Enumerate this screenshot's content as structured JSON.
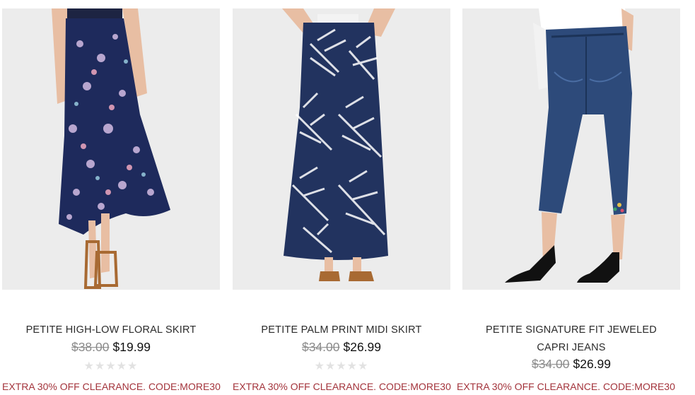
{
  "products": [
    {
      "name": "PETITE HIGH-LOW FLORAL SKIRT",
      "original_price": "$38.00",
      "sale_price": "$19.99",
      "rating_stars": "★★★★★",
      "rating_filled": 0,
      "promo": "EXTRA 30% OFF CLEARANCE. CODE:MORE30"
    },
    {
      "name": "PETITE PALM PRINT MIDI SKIRT",
      "original_price": "$34.00",
      "sale_price": "$26.99",
      "rating_stars": "★★★★★",
      "rating_filled": 0,
      "promo": "EXTRA 30% OFF CLEARANCE. CODE:MORE30"
    },
    {
      "name_line1": "PETITE SIGNATURE FIT JEWELED",
      "name_line2": "CAPRI JEANS",
      "original_price": "$34.00",
      "sale_price": "$26.99",
      "promo": "EXTRA 30% OFF CLEARANCE. CODE:MORE30"
    }
  ],
  "colors": {
    "promo_text": "#a3333b",
    "strike_price": "#8a8a8a",
    "photo_background": "#ececec",
    "star_empty": "#e2e2e2"
  }
}
